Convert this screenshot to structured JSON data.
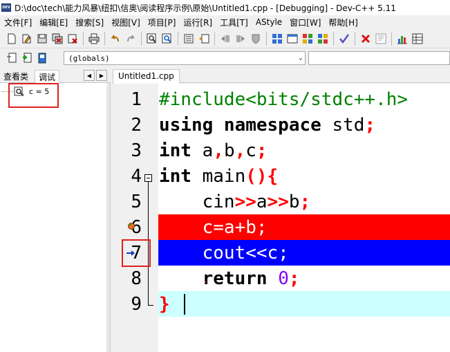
{
  "window": {
    "title": "D:\\doc\\tech\\能力风暴\\纽扣\\信奥\\阅读程序示例\\原始\\Untitled1.cpp - [Debugging] - Dev-C++ 5.11",
    "app_icon_text": "DEV"
  },
  "menu": [
    {
      "label": "文件[F]"
    },
    {
      "label": "编辑[E]"
    },
    {
      "label": "搜索[S]"
    },
    {
      "label": "视图[V]"
    },
    {
      "label": "项目[P]"
    },
    {
      "label": "运行[R]"
    },
    {
      "label": "工具[T]"
    },
    {
      "label": "AStyle"
    },
    {
      "label": "窗口[W]"
    },
    {
      "label": "帮助[H]"
    }
  ],
  "toolbar2": {
    "scope_combo": "(globals)"
  },
  "left_panel": {
    "tabs": [
      "查看类",
      "调试"
    ],
    "active_tab": "调试",
    "watch_items": [
      {
        "text": "c = 5"
      }
    ]
  },
  "editor": {
    "tab_label": "Untitled1.cpp",
    "lines": [
      {
        "n": "1"
      },
      {
        "n": "2"
      },
      {
        "n": "3"
      },
      {
        "n": "4"
      },
      {
        "n": "5"
      },
      {
        "n": "6"
      },
      {
        "n": "7"
      },
      {
        "n": "8"
      },
      {
        "n": "9"
      }
    ]
  },
  "colors": {
    "breakpoint_line": "#ff0000",
    "current_line": "#0000ff",
    "caret_line": "#ccffff",
    "preprocessor": "#008000",
    "symbol": "#ff0000",
    "number": "#8000ff"
  },
  "icons": [
    "new-file-icon",
    "open-icon",
    "save-icon",
    "save-all-icon",
    "close-icon",
    "print-icon",
    "undo-icon",
    "redo-icon",
    "find-icon",
    "replace-icon",
    "compile-icon",
    "run-icon",
    "chart-icon",
    "check-icon",
    "stop-icon",
    "breakpoint-icon",
    "current-line-arrow-icon",
    "watch-icon"
  ]
}
